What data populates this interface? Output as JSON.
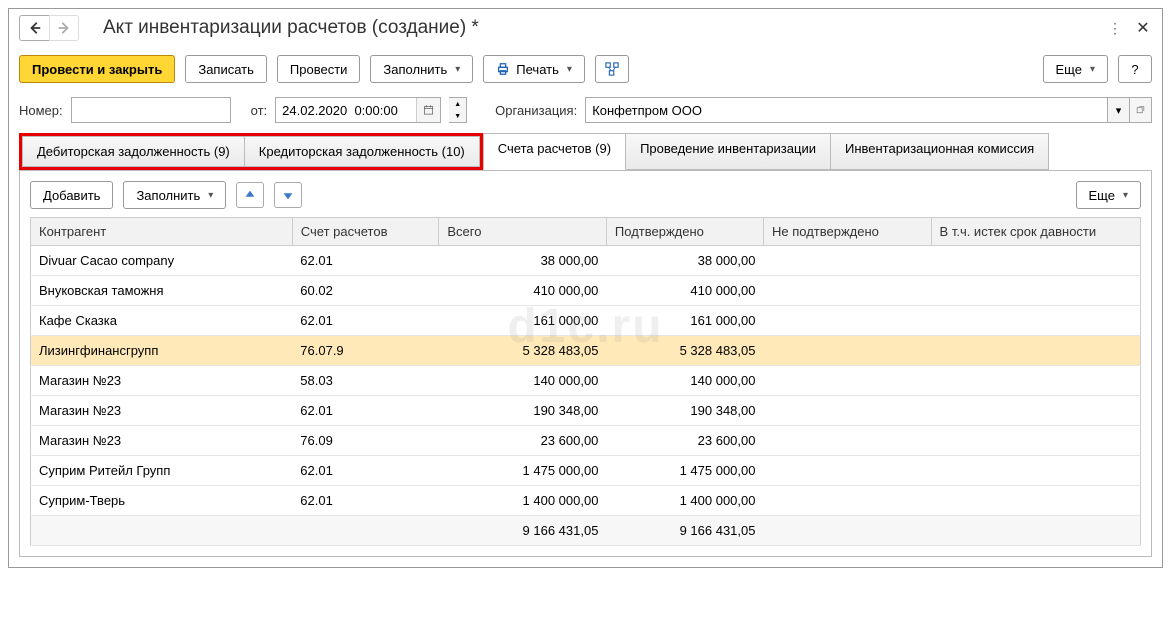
{
  "title": "Акт инвентаризации расчетов (создание) *",
  "toolbar": {
    "post_close": "Провести и закрыть",
    "write": "Записать",
    "post": "Провести",
    "fill": "Заполнить",
    "print": "Печать",
    "more": "Еще"
  },
  "form": {
    "number_label": "Номер:",
    "number_value": "",
    "from_label": "от:",
    "date_value": "24.02.2020  0:00:00",
    "org_label": "Организация:",
    "org_value": "Конфетпром ООО"
  },
  "tabs": {
    "debit": "Дебиторская задолженность (9)",
    "credit": "Кредиторская задолженность (10)",
    "accounts": "Счета расчетов (9)",
    "inventory": "Проведение инвентаризации",
    "commission": "Инвентаризационная комиссия"
  },
  "tab_toolbar": {
    "add": "Добавить",
    "fill": "Заполнить",
    "more": "Еще"
  },
  "table": {
    "headers": {
      "counterparty": "Контрагент",
      "account": "Счет расчетов",
      "total": "Всего",
      "confirmed": "Подтверждено",
      "unconfirmed": "Не подтверждено",
      "expired": "В т.ч. истек срок давности"
    },
    "rows": [
      {
        "counterparty": "Divuar Cacao company",
        "account": "62.01",
        "total": "38 000,00",
        "confirmed": "38 000,00",
        "selected": false
      },
      {
        "counterparty": "Внуковская таможня",
        "account": "60.02",
        "total": "410 000,00",
        "confirmed": "410 000,00",
        "selected": false
      },
      {
        "counterparty": "Кафе Сказка",
        "account": "62.01",
        "total": "161 000,00",
        "confirmed": "161 000,00",
        "selected": false
      },
      {
        "counterparty": "Лизингфинансгрупп",
        "account": "76.07.9",
        "total": "5 328 483,05",
        "confirmed": "5 328 483,05",
        "selected": true
      },
      {
        "counterparty": "Магазин №23",
        "account": "58.03",
        "total": "140 000,00",
        "confirmed": "140 000,00",
        "selected": false
      },
      {
        "counterparty": "Магазин №23",
        "account": "62.01",
        "total": "190 348,00",
        "confirmed": "190 348,00",
        "selected": false
      },
      {
        "counterparty": "Магазин №23",
        "account": "76.09",
        "total": "23 600,00",
        "confirmed": "23 600,00",
        "selected": false
      },
      {
        "counterparty": "Суприм Ритейл Групп",
        "account": "62.01",
        "total": "1 475 000,00",
        "confirmed": "1 475 000,00",
        "selected": false
      },
      {
        "counterparty": "Суприм-Тверь",
        "account": "62.01",
        "total": "1 400 000,00",
        "confirmed": "1 400 000,00",
        "selected": false
      }
    ],
    "footer": {
      "total": "9 166 431,05",
      "confirmed": "9 166 431,05"
    }
  },
  "watermark": "d1c.ru"
}
